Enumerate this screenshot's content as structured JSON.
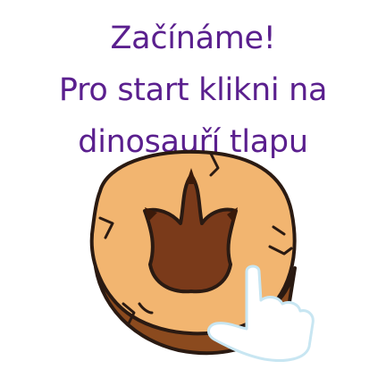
{
  "intro": {
    "line1": "Začínáme!",
    "line2": "Pro start klikni na",
    "line3": "dinosauří tlapu"
  },
  "colors": {
    "text": "#5a1f8e",
    "stone_face": "#f2b570",
    "stone_side": "#8b4a1e",
    "footprint": "#7a3a1a",
    "outline": "#2a1a12",
    "hand": "#ffffff",
    "hand_shadow": "#c8e6f2"
  },
  "icons": {
    "paw": "dino-paw-stone-icon",
    "hand": "pointing-hand-icon"
  }
}
